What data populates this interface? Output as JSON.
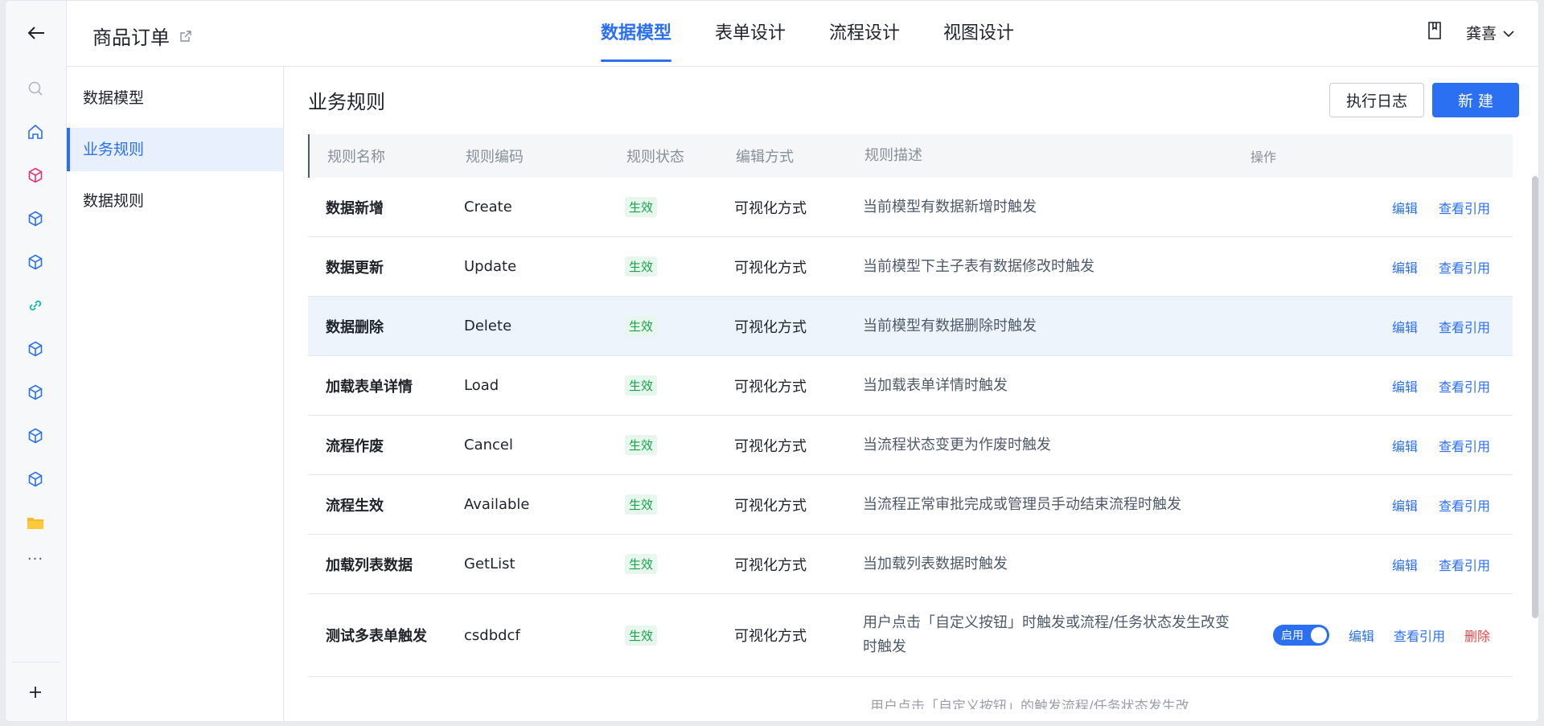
{
  "header": {
    "app_title": "商品订单",
    "tabs": [
      {
        "label": "数据模型",
        "active": true
      },
      {
        "label": "表单设计",
        "active": false
      },
      {
        "label": "流程设计",
        "active": false
      },
      {
        "label": "视图设计",
        "active": false
      }
    ],
    "user_name": "龚喜"
  },
  "subnav": {
    "items": [
      {
        "label": "数据模型",
        "active": false
      },
      {
        "label": "业务规则",
        "active": true
      },
      {
        "label": "数据规则",
        "active": false
      }
    ]
  },
  "rail": {
    "icons": [
      "search-icon",
      "home-icon",
      "cube-icon",
      "cube-icon",
      "cube-icon",
      "link-icon",
      "cube-icon",
      "cube-icon",
      "cube-icon",
      "cube-icon",
      "folder-icon"
    ],
    "more_label": "···"
  },
  "content": {
    "title": "业务规则",
    "log_button": "执行日志",
    "new_button": "新 建"
  },
  "table": {
    "headers": [
      "规则名称",
      "规则编码",
      "规则状态",
      "编辑方式",
      "规则描述",
      "操作"
    ],
    "rows": [
      {
        "name": "数据新增",
        "code": "Create",
        "status": "生效",
        "mode": "可视化方式",
        "desc": "当前模型有数据新增时触发"
      },
      {
        "name": "数据更新",
        "code": "Update",
        "status": "生效",
        "mode": "可视化方式",
        "desc": "当前模型下主子表有数据修改时触发"
      },
      {
        "name": "数据删除",
        "code": "Delete",
        "status": "生效",
        "mode": "可视化方式",
        "desc": "当前模型有数据删除时触发"
      },
      {
        "name": "加载表单详情",
        "code": "Load",
        "status": "生效",
        "mode": "可视化方式",
        "desc": "当加载表单详情时触发"
      },
      {
        "name": "流程作废",
        "code": "Cancel",
        "status": "生效",
        "mode": "可视化方式",
        "desc": "当流程状态变更为作废时触发"
      },
      {
        "name": "流程生效",
        "code": "Available",
        "status": "生效",
        "mode": "可视化方式",
        "desc": "当流程正常审批完成或管理员手动结束流程时触发"
      },
      {
        "name": "加载列表数据",
        "code": "GetList",
        "status": "生效",
        "mode": "可视化方式",
        "desc": "当加载列表数据时触发"
      }
    ],
    "action_edit": "编辑",
    "action_refs": "查看引用",
    "custom_row": {
      "name": "测试多表单触发",
      "code": "csdbdcf",
      "status": "生效",
      "mode": "可视化方式",
      "desc": "用户点击「自定义按钮」时触发或流程/任务状态发生改变时触发",
      "toggle_label": "启用",
      "edit": "编辑",
      "refs": "查看引用",
      "delete": "删除"
    },
    "partial_row_desc": "用户点击「自定义按钮」的触发流程/任务状态发生改"
  },
  "colors": {
    "accent": "#2b6ff3",
    "success": "#16a34a",
    "danger": "#e54545"
  }
}
